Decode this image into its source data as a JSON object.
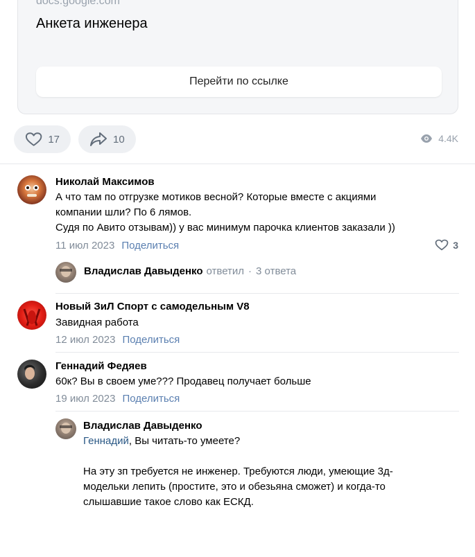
{
  "link_card": {
    "domain": "docs.google.com",
    "title": "Анкета инженера",
    "button_label": "Перейти по ссылке"
  },
  "post_actions": {
    "likes": "17",
    "shares": "10",
    "views": "4.4K"
  },
  "comments": [
    {
      "author": "Николай Максимов",
      "text_lines": [
        "А что там по отгрузке мотиков весной? Которые вместе с акциями",
        "компании шли? По 6 лямов.",
        "Судя по Авито отзывам)) у вас минимум парочка клиентов заказали ))"
      ],
      "date": "11 июл 2023",
      "share_label": "Поделиться",
      "likes": "3",
      "reply_summary": {
        "author": "Владислав Давыденко",
        "action": "ответил",
        "count": "3 ответа"
      }
    },
    {
      "author": "Новый ЗиЛ Спорт с самодельным V8",
      "text_lines": [
        "Завидная работа"
      ],
      "date": "12 июл 2023",
      "share_label": "Поделиться"
    },
    {
      "author": "Геннадий Федяев",
      "text_lines": [
        "60к? Вы в своем уме??? Продавец получает больше"
      ],
      "date": "19 июл 2023",
      "share_label": "Поделиться",
      "reply": {
        "author": "Владислав Давыденко",
        "mention": "Геннадий",
        "first_line_rest": ", Вы читать-то умеете?",
        "body_lines": [
          "На эту зп требуется не инженер. Требуются люди, умеющие 3д-",
          "модельки лепить (простите, это и обезьяна сможет) и когда-то",
          "слышавшие такое слово как ЕСКД."
        ]
      }
    }
  ],
  "colors": {
    "accent_link": "#5a7fb0",
    "muted": "#818c99",
    "pill_bg": "#eef0f3"
  },
  "icons": [
    "heart-icon",
    "share-arrow-icon",
    "eye-icon"
  ]
}
